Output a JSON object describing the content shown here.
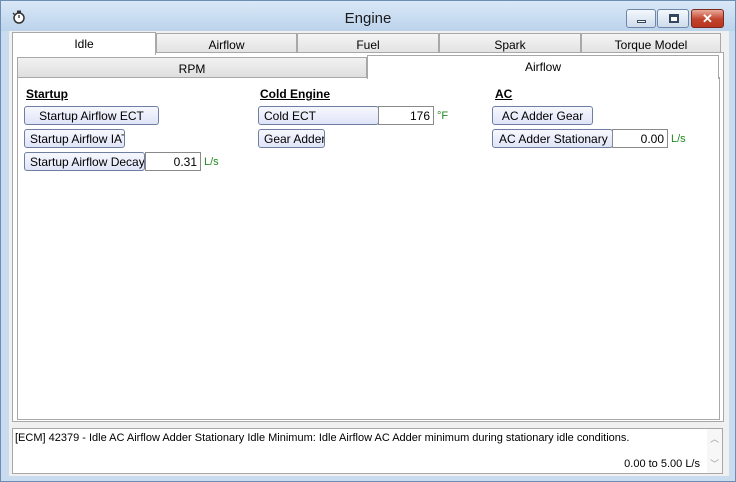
{
  "window": {
    "title": "Engine"
  },
  "icons": {
    "app": "stopwatch-icon",
    "minimize": "minimize-icon",
    "maximize": "maximize-icon",
    "close": "close-icon"
  },
  "tabs": [
    "Idle",
    "Airflow",
    "Fuel",
    "Spark",
    "Torque Model"
  ],
  "active_tab": "Idle",
  "subtabs": [
    "RPM",
    "Airflow"
  ],
  "active_subtab": "Airflow",
  "sections": {
    "startup": {
      "title": "Startup",
      "ect_label": "Startup Airflow ECT",
      "iat_label": "Startup Airflow IAT",
      "decay_label": "Startup Airflow Decay",
      "decay_value": "0.31",
      "decay_unit": "L/s"
    },
    "cold": {
      "title": "Cold Engine",
      "ect_label": "Cold ECT",
      "ect_value": "176",
      "ect_unit": "°F",
      "gear_label": "Gear Adder"
    },
    "ac": {
      "title": "AC",
      "gear_label": "AC Adder Gear",
      "stationary_label": "AC Adder Stationary Minimum",
      "stationary_value": "0.00",
      "stationary_unit": "L/s"
    }
  },
  "status": {
    "text": "[ECM] 42379 - Idle AC Airflow Adder Stationary Idle Minimum: Idle Airflow AC Adder minimum during stationary idle conditions.",
    "range": "0.00 to 5.00 L/s"
  },
  "colors": {
    "unit": "#1f8a1f",
    "close": "#c2432d"
  }
}
